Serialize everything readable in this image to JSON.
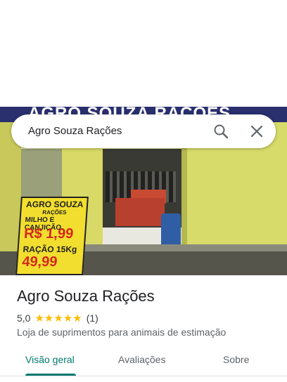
{
  "search": {
    "query": "Agro Souza Rações",
    "search_icon": "search-icon",
    "close_icon": "close-icon"
  },
  "photo": {
    "sign_text": "AGRO SOUZA RAÇÕES",
    "board_lines": [
      "AGRO SOUZA",
      "RAÇÕES",
      "MILHO E CANJICÃO",
      "R$ 1,99",
      "RAÇÃO 15Kg",
      "49,99"
    ]
  },
  "place": {
    "name": "Agro Souza Rações",
    "rating": "5,0",
    "stars": 5,
    "review_count": "(1)",
    "category": "Loja de suprimentos para animais de estimação"
  },
  "tabs": [
    {
      "label": "Visão geral",
      "active": true
    },
    {
      "label": "Avaliações",
      "active": false
    },
    {
      "label": "Sobre",
      "active": false
    }
  ],
  "colors": {
    "accent": "#01796f",
    "star": "#fbbc04"
  }
}
